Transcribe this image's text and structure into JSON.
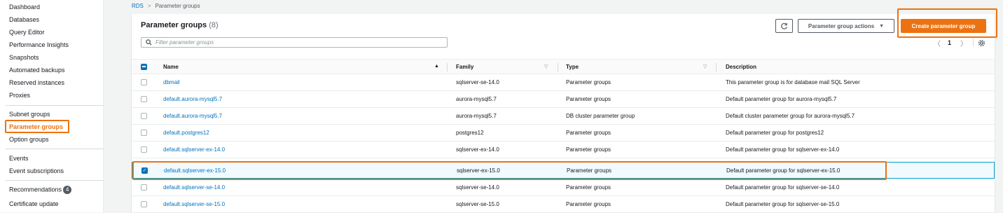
{
  "sidebar": {
    "items": [
      {
        "label": "Dashboard"
      },
      {
        "label": "Databases"
      },
      {
        "label": "Query Editor"
      },
      {
        "label": "Performance Insights"
      },
      {
        "label": "Snapshots"
      },
      {
        "label": "Automated backups"
      },
      {
        "label": "Reserved instances"
      },
      {
        "label": "Proxies"
      },
      {
        "label": "Subnet groups"
      },
      {
        "label": "Parameter groups"
      },
      {
        "label": "Option groups"
      },
      {
        "label": "Events"
      },
      {
        "label": "Event subscriptions"
      },
      {
        "label": "Recommendations",
        "badge": "4"
      },
      {
        "label": "Certificate update"
      }
    ],
    "active": "Parameter groups"
  },
  "breadcrumb": {
    "root": "RDS",
    "separator": ">",
    "current": "Parameter groups"
  },
  "panel": {
    "title": "Parameter groups",
    "count": "(8)",
    "refresh_icon": "refresh-icon",
    "actions_label": "Parameter group actions",
    "create_label": "Create parameter group",
    "search_placeholder": "Filter parameter groups",
    "page": "1"
  },
  "table": {
    "columns": [
      "Name",
      "Family",
      "Type",
      "Description"
    ],
    "rows": [
      {
        "name": "dbmail",
        "family": "sqlserver-se-14.0",
        "type": "Parameter groups",
        "description": "This parameter group is for database mail SQL Server",
        "checked": false
      },
      {
        "name": "default.aurora-mysql5.7",
        "family": "aurora-mysql5.7",
        "type": "Parameter groups",
        "description": "Default parameter group for aurora-mysql5.7",
        "checked": false
      },
      {
        "name": "default.aurora-mysql5.7",
        "family": "aurora-mysql5.7",
        "type": "DB cluster parameter group",
        "description": "Default cluster parameter group for aurora-mysql5.7",
        "checked": false
      },
      {
        "name": "default.postgres12",
        "family": "postgres12",
        "type": "Parameter groups",
        "description": "Default parameter group for postgres12",
        "checked": false
      },
      {
        "name": "default.sqlserver-ex-14.0",
        "family": "sqlserver-ex-14.0",
        "type": "Parameter groups",
        "description": "Default parameter group for sqlserver-ex-14.0",
        "checked": false
      },
      {
        "name": "default.sqlserver-ex-15.0",
        "family": "sqlserver-ex-15.0",
        "type": "Parameter groups",
        "description": "Default parameter group for sqlserver-ex-15.0",
        "checked": true
      },
      {
        "name": "default.sqlserver-se-14.0",
        "family": "sqlserver-se-14.0",
        "type": "Parameter groups",
        "description": "Default parameter group for sqlserver-se-14.0",
        "checked": false
      },
      {
        "name": "default.sqlserver-se-15.0",
        "family": "sqlserver-se-15.0",
        "type": "Parameter groups",
        "description": "Default parameter group for sqlserver-se-15.0",
        "checked": false
      }
    ]
  },
  "colors": {
    "accent": "#ec7211",
    "link": "#0073bb",
    "selected_border": "#00a1c9",
    "highlight": "#ec7211"
  }
}
